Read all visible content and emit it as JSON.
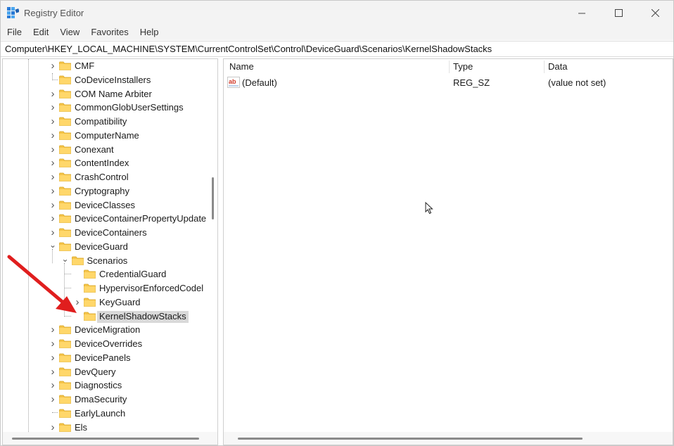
{
  "window": {
    "title": "Registry Editor",
    "controls": {
      "minimize": "minimize-icon",
      "maximize": "maximize-icon",
      "close": "close-icon"
    }
  },
  "menu": [
    "File",
    "Edit",
    "View",
    "Favorites",
    "Help"
  ],
  "address": "Computer\\HKEY_LOCAL_MACHINE\\SYSTEM\\CurrentControlSet\\Control\\DeviceGuard\\Scenarios\\KernelShadowStacks",
  "tree": {
    "items": [
      {
        "label": "CMF",
        "level": 0,
        "expander": "collapsed"
      },
      {
        "label": "CoDeviceInstallers",
        "level": 0,
        "expander": "none"
      },
      {
        "label": "COM Name Arbiter",
        "level": 0,
        "expander": "collapsed"
      },
      {
        "label": "CommonGlobUserSettings",
        "level": 0,
        "expander": "collapsed"
      },
      {
        "label": "Compatibility",
        "level": 0,
        "expander": "collapsed"
      },
      {
        "label": "ComputerName",
        "level": 0,
        "expander": "collapsed"
      },
      {
        "label": "Conexant",
        "level": 0,
        "expander": "collapsed"
      },
      {
        "label": "ContentIndex",
        "level": 0,
        "expander": "collapsed"
      },
      {
        "label": "CrashControl",
        "level": 0,
        "expander": "collapsed"
      },
      {
        "label": "Cryptography",
        "level": 0,
        "expander": "collapsed"
      },
      {
        "label": "DeviceClasses",
        "level": 0,
        "expander": "collapsed"
      },
      {
        "label": "DeviceContainerPropertyUpdate",
        "level": 0,
        "expander": "collapsed"
      },
      {
        "label": "DeviceContainers",
        "level": 0,
        "expander": "collapsed"
      },
      {
        "label": "DeviceGuard",
        "level": 0,
        "expander": "expanded"
      },
      {
        "label": "Scenarios",
        "level": 1,
        "expander": "expanded"
      },
      {
        "label": "CredentialGuard",
        "level": 2,
        "expander": "none"
      },
      {
        "label": "HypervisorEnforcedCodel",
        "level": 2,
        "expander": "none"
      },
      {
        "label": "KeyGuard",
        "level": 2,
        "expander": "collapsed"
      },
      {
        "label": "KernelShadowStacks",
        "level": 2,
        "expander": "none",
        "selected": true
      },
      {
        "label": "DeviceMigration",
        "level": 0,
        "expander": "collapsed"
      },
      {
        "label": "DeviceOverrides",
        "level": 0,
        "expander": "collapsed"
      },
      {
        "label": "DevicePanels",
        "level": 0,
        "expander": "collapsed"
      },
      {
        "label": "DevQuery",
        "level": 0,
        "expander": "collapsed"
      },
      {
        "label": "Diagnostics",
        "level": 0,
        "expander": "collapsed"
      },
      {
        "label": "DmaSecurity",
        "level": 0,
        "expander": "collapsed"
      },
      {
        "label": "EarlyLaunch",
        "level": 0,
        "expander": "none"
      },
      {
        "label": "Els",
        "level": 0,
        "expander": "collapsed"
      }
    ]
  },
  "list": {
    "columns": [
      "Name",
      "Type",
      "Data"
    ],
    "rows": [
      {
        "icon": "string-value-icon",
        "name": "(Default)",
        "type": "REG_SZ",
        "data": "(value not set)"
      }
    ]
  },
  "colors": {
    "folder": "#f5c44a",
    "selection": "#d9d9d9",
    "annotation_arrow": "#e01e1e",
    "chrome": "#f3f3f3"
  }
}
